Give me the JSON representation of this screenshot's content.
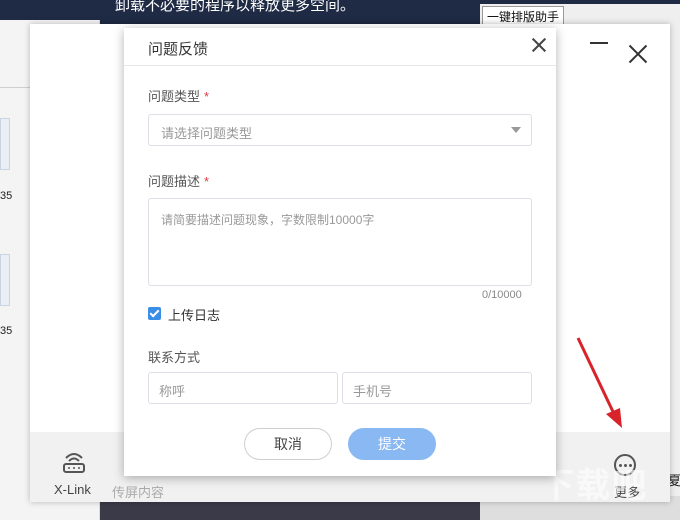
{
  "background": {
    "top_text": "卸载不必要的程序以释放更多空间。",
    "right_tab": "一键排版助手",
    "thumb_labels": [
      "35",
      "35"
    ],
    "right_edge_text": "夏"
  },
  "main_window": {
    "footer": {
      "xlink_label": "X-Link",
      "mirror_label": "传屏内容",
      "more_label": "更多"
    }
  },
  "watermark": "下载吧",
  "dialog": {
    "title": "问题反馈",
    "type_label": "问题类型",
    "required_mark": "*",
    "type_placeholder": "请选择问题类型",
    "desc_label": "问题描述",
    "desc_placeholder": "请简要描述问题现象，字数限制10000字",
    "counter": "0/10000",
    "upload_log_label": "上传日志",
    "upload_log_checked": true,
    "contact_label": "联系方式",
    "name_placeholder": "称呼",
    "phone_placeholder": "手机号",
    "cancel_label": "取消",
    "submit_label": "提交"
  },
  "colors": {
    "primary": "#3a8ee6",
    "submit_disabled": "#8ab8f2",
    "required": "#e0393e",
    "arrow": "#d9232a"
  }
}
